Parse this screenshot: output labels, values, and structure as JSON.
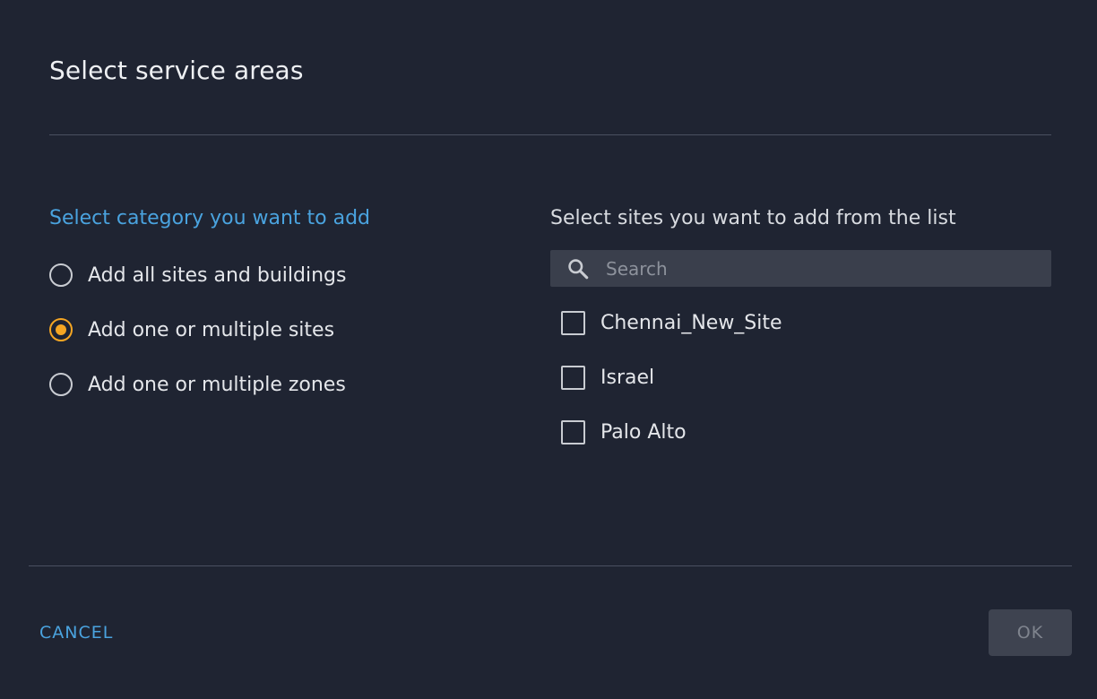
{
  "dialog": {
    "title": "Select service areas"
  },
  "category": {
    "heading": "Select category you want to add",
    "options": [
      {
        "label": "Add all sites and buildings",
        "checked": false
      },
      {
        "label": "Add one or multiple sites",
        "checked": true
      },
      {
        "label": "Add one or multiple zones",
        "checked": false
      }
    ]
  },
  "sites": {
    "heading": "Select sites you want to add from the list",
    "search": {
      "placeholder": "Search",
      "value": "",
      "icon": "search-icon"
    },
    "items": [
      {
        "label": "Chennai_New_Site",
        "checked": false
      },
      {
        "label": "Israel",
        "checked": false
      },
      {
        "label": "Palo Alto",
        "checked": false
      }
    ]
  },
  "footer": {
    "cancel_label": "CANCEL",
    "ok_label": "OK"
  },
  "colors": {
    "background": "#1f2432",
    "accent_link": "#4aa3df",
    "radio_selected": "#f5a623",
    "search_bg": "#3a3f4c",
    "ok_disabled_bg": "#3e4350"
  }
}
